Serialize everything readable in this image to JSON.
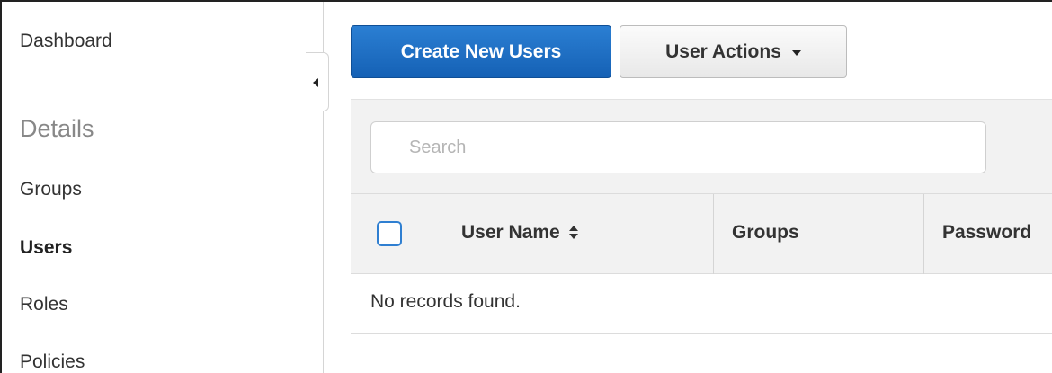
{
  "sidebar": {
    "dashboard": "Dashboard",
    "details_heading": "Details",
    "items": [
      {
        "label": "Groups"
      },
      {
        "label": "Users"
      },
      {
        "label": "Roles"
      },
      {
        "label": "Policies"
      }
    ],
    "active_item": "Users"
  },
  "toolbar": {
    "create_label": "Create New Users",
    "actions_label": "User Actions"
  },
  "search": {
    "placeholder": "Search",
    "value": ""
  },
  "table": {
    "columns": [
      "User Name",
      "Groups",
      "Password"
    ],
    "empty_message": "No records found."
  },
  "colors": {
    "primary": "#1f6fc5",
    "checkbox_border": "#2f7fd1",
    "header_bg": "#f2f2f2"
  }
}
